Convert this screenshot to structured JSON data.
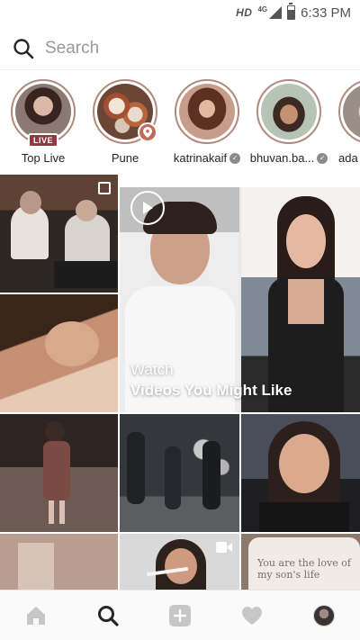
{
  "status_bar": {
    "hd": "HD",
    "network": "4G",
    "time": "6:33 PM"
  },
  "search": {
    "placeholder": "Search",
    "icon": "search-icon"
  },
  "stories": [
    {
      "label": "Top Live",
      "badge": "LIVE",
      "verified": false,
      "icon": "avatar"
    },
    {
      "label": "Pune",
      "badge": "",
      "verified": false,
      "icon": "location-pin-icon"
    },
    {
      "label": "katrinakaif",
      "badge": "",
      "verified": true,
      "icon": "verified-icon"
    },
    {
      "label": "bhuvan.ba...",
      "badge": "",
      "verified": true,
      "icon": "verified-icon"
    },
    {
      "label": "ada",
      "badge": "",
      "verified": false,
      "icon": "avatar"
    }
  ],
  "explore": {
    "video_promo": {
      "line1": "Watch",
      "line2": "Videos You Might Like"
    },
    "tiles": [
      {
        "name": "post-musicians-studio"
      },
      {
        "name": "post-woman-portrait"
      },
      {
        "name": "post-boy-selfie"
      },
      {
        "name": "post-woman-pose"
      },
      {
        "name": "post-woman-dress"
      },
      {
        "name": "post-dancers"
      },
      {
        "name": "post-woman-smiling"
      },
      {
        "name": "post-partial-1"
      },
      {
        "name": "post-woman-toothbrush"
      },
      {
        "name": "post-mug-quote"
      }
    ],
    "mug_text": "You are the love of my son's life"
  },
  "nav": {
    "items": [
      "home-icon",
      "search-icon",
      "add-post-icon",
      "heart-icon",
      "profile-avatar"
    ]
  },
  "colors": {
    "accent": "#8e3a40",
    "ring": "#b08a7c",
    "icon": "#262626",
    "muted_icon": "#c7c7c7"
  }
}
